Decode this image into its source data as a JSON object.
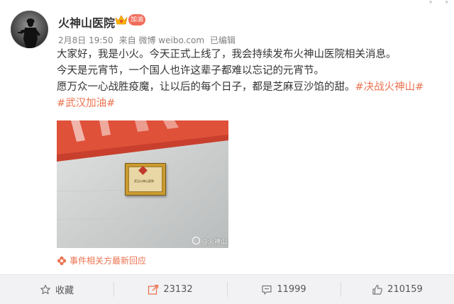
{
  "account": {
    "name": "火神山医院",
    "badge_text": "加油",
    "avatar_icon": "soldier-silhouette-avatar"
  },
  "meta": {
    "date": "2月8日 19:50",
    "source": "来自 微博 weibo.com",
    "edited": "已编辑"
  },
  "post": {
    "line1": "大家好，我是小火。今天正式上线了，我会持续发布火神山医院相关消息。",
    "line2": "今天是元宵节，一个国人也许这辈子都难以忘记的元宵节。",
    "line3": "愿万众一心战胜疫魔，让以后的每个日子，都是芝麻豆沙馅的甜。",
    "hashtag1": "#决战火神山#",
    "hashtag2": "#武汉加油#"
  },
  "photo": {
    "plaque_text": "武汉火神山医院",
    "watermark": "@火神山"
  },
  "related": {
    "label": "事件相关方最新回应"
  },
  "actions": {
    "favorite_label": "收藏",
    "repost_count": "23132",
    "comment_count": "11999",
    "like_count": "210159"
  },
  "colors": {
    "accent": "#eb7350",
    "badge": "#f06d5c",
    "action_bar_bg": "#f2f2f5"
  }
}
